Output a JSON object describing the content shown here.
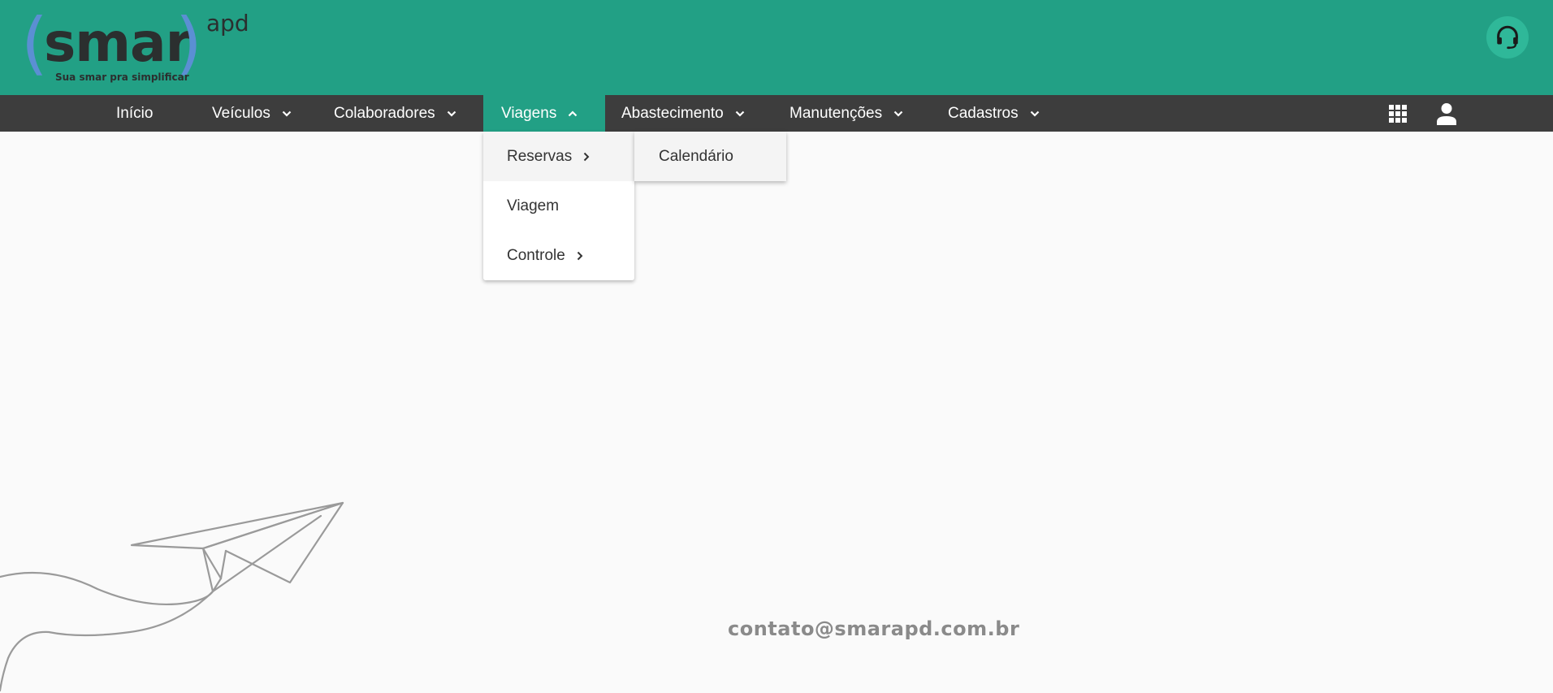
{
  "logo": {
    "word": "smar",
    "sup": "apd",
    "tagline": "Sua smar pra simplificar",
    "paren_left": "(",
    "paren_right": ")"
  },
  "colors": {
    "header": "#22a085",
    "navbar": "#3d3d3d",
    "accent": "#22a085",
    "logo_paren": "#5b8fd3"
  },
  "nav": {
    "items": [
      {
        "label": "Início",
        "has_dropdown": false
      },
      {
        "label": "Veículos",
        "has_dropdown": true
      },
      {
        "label": "Colaboradores",
        "has_dropdown": true
      },
      {
        "label": "Viagens",
        "has_dropdown": true,
        "active": true
      },
      {
        "label": "Abastecimento",
        "has_dropdown": true
      },
      {
        "label": "Manutenções",
        "has_dropdown": true
      },
      {
        "label": "Cadastros",
        "has_dropdown": true
      }
    ],
    "icons": [
      "apps-grid-icon",
      "user-icon"
    ]
  },
  "viagens_menu": {
    "items": [
      {
        "label": "Reservas",
        "has_submenu": true
      },
      {
        "label": "Viagem",
        "has_submenu": false
      },
      {
        "label": "Controle",
        "has_submenu": true
      }
    ]
  },
  "reservas_submenu": {
    "items": [
      {
        "label": "Calendário"
      }
    ]
  },
  "footer": {
    "contact": "contato@smarapd.com.br"
  },
  "header": {
    "support_icon": "headset-icon"
  }
}
